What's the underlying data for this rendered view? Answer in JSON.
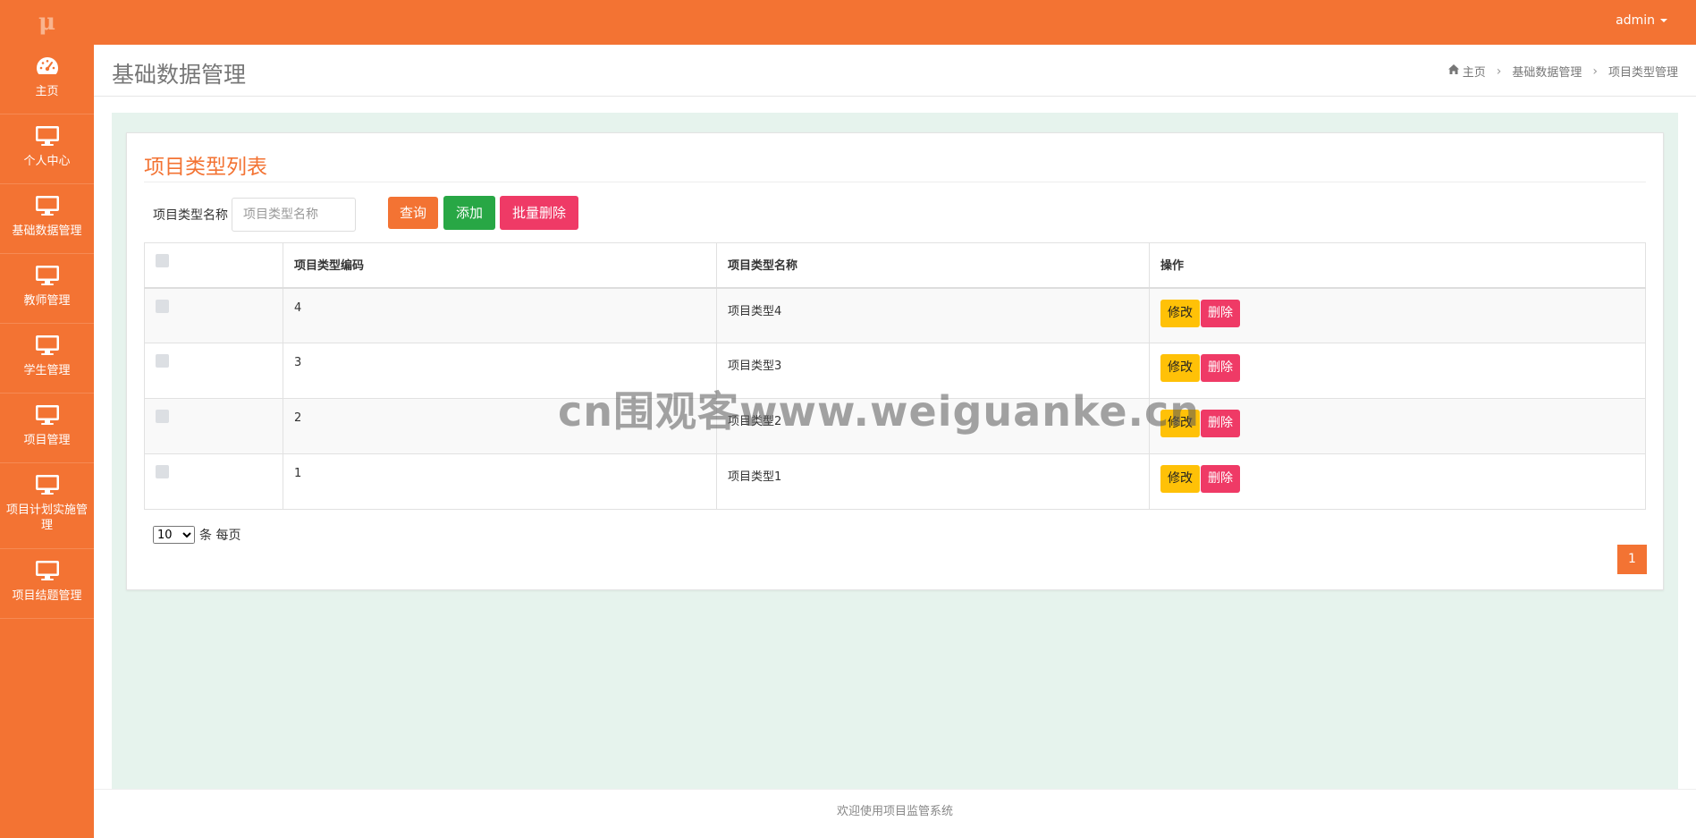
{
  "topbar": {
    "logo": "μ",
    "user": "admin"
  },
  "sidebar": {
    "items": [
      {
        "label": "主页",
        "icon": "dashboard-icon"
      },
      {
        "label": "个人中心",
        "icon": "monitor-icon"
      },
      {
        "label": "基础数据管理",
        "icon": "monitor-icon"
      },
      {
        "label": "教师管理",
        "icon": "monitor-icon"
      },
      {
        "label": "学生管理",
        "icon": "monitor-icon"
      },
      {
        "label": "项目管理",
        "icon": "monitor-icon"
      },
      {
        "label": "项目计划实施管理",
        "icon": "monitor-icon"
      },
      {
        "label": "项目结题管理",
        "icon": "monitor-icon"
      }
    ]
  },
  "header": {
    "title": "基础数据管理",
    "breadcrumb": [
      "主页",
      "基础数据管理",
      "项目类型管理"
    ]
  },
  "panel": {
    "title": "项目类型列表",
    "search_label": "项目类型名称",
    "search_placeholder": "项目类型名称",
    "query_label": "查询",
    "add_label": "添加",
    "batch_delete_label": "批量删除"
  },
  "table": {
    "headers": [
      "",
      "项目类型编码",
      "项目类型名称",
      "操作"
    ],
    "rows": [
      {
        "code": "4",
        "name": "项目类型4"
      },
      {
        "code": "3",
        "name": "项目类型3"
      },
      {
        "code": "2",
        "name": "项目类型2"
      },
      {
        "code": "1",
        "name": "项目类型1"
      }
    ],
    "edit_label": "修改",
    "delete_label": "删除"
  },
  "pagination": {
    "page_size": "10",
    "page_size_suffix": "条 每页",
    "current_page": "1"
  },
  "footer": {
    "text": "欢迎使用项目监管系统"
  },
  "watermark": "cn围观客www.weiguanke.cn",
  "colors": {
    "accent": "#f37333",
    "success": "#28a745",
    "danger": "#ef3a66",
    "warning": "#ffc107",
    "main_bg": "#e6f3ed"
  }
}
